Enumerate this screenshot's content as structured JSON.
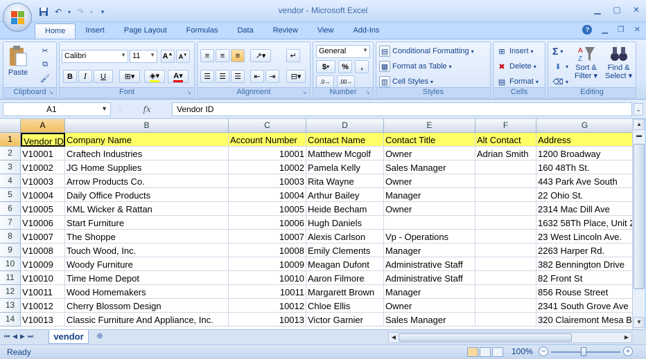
{
  "window": {
    "title": "vendor - Microsoft Excel"
  },
  "ribbon_tabs": [
    "Home",
    "Insert",
    "Page Layout",
    "Formulas",
    "Data",
    "Review",
    "View",
    "Add-Ins"
  ],
  "ribbon": {
    "clipboard": {
      "label": "Clipboard",
      "paste": "Paste"
    },
    "font": {
      "label": "Font",
      "name": "Calibri",
      "size": "11",
      "bold": "B",
      "italic": "I",
      "underline": "U"
    },
    "alignment": {
      "label": "Alignment"
    },
    "number": {
      "label": "Number",
      "format": "General",
      "currency": "$",
      "percent": "%",
      "comma": ","
    },
    "styles": {
      "label": "Styles",
      "conditional": "Conditional Formatting",
      "format_table": "Format as Table",
      "cell_styles": "Cell Styles"
    },
    "cells": {
      "label": "Cells",
      "insert": "Insert",
      "delete": "Delete",
      "format": "Format"
    },
    "editing": {
      "label": "Editing",
      "sum": "Σ",
      "sort": "Sort &",
      "filter": "Filter",
      "find": "Find &",
      "select": "Select"
    }
  },
  "formula_bar": {
    "name_box": "A1",
    "fx": "fx",
    "content": "Vendor ID"
  },
  "grid": {
    "columns": [
      "A",
      "B",
      "C",
      "D",
      "E",
      "F",
      "G"
    ],
    "rows": [
      [
        "Vendor ID",
        "Company Name",
        "Account Number",
        "Contact Name",
        "Contact Title",
        "Alt Contact",
        "Address"
      ],
      [
        "V10001",
        "Craftech Industries",
        "10001",
        "Matthew Mcgolf",
        "Owner",
        "Adrian Smith",
        "1200 Broadway"
      ],
      [
        "V10002",
        "JG Home Supplies",
        "10002",
        "Pamela Kelly",
        "Sales Manager",
        "",
        "160 48Th St."
      ],
      [
        "V10003",
        "Arrow Products Co.",
        "10003",
        "Rita Wayne",
        "Owner",
        "",
        "443 Park Ave South"
      ],
      [
        "V10004",
        "Daily Office Products",
        "10004",
        "Arthur Bailey",
        "Manager",
        "",
        "22 Ohio St."
      ],
      [
        "V10005",
        "KML Wicker & Rattan",
        "10005",
        "Heide Becham",
        "Owner",
        "",
        "2314 Mac Dill Ave"
      ],
      [
        "V10006",
        "Start Furniture",
        "10006",
        "Hugh Daniels",
        "",
        "",
        "1632 58Th Place, Unit 2"
      ],
      [
        "V10007",
        "The Shoppe",
        "10007",
        "Alexis Carlson",
        "Vp - Operations",
        "",
        "23 West Lincoln Ave."
      ],
      [
        "V10008",
        "Touch Wood, Inc.",
        "10008",
        "Emily Clements",
        "Manager",
        "",
        "2263 Harper Rd."
      ],
      [
        "V10009",
        "Woody Furniture",
        "10009",
        "Meagan Dufont",
        "Administrative Staff",
        "",
        "382 Bennington Drive"
      ],
      [
        "V10010",
        "Time Home Depot",
        "10010",
        "Aaron Filmore",
        "Administrative Staff",
        "",
        "82 Front St"
      ],
      [
        "V10011",
        "Wood Homemakers",
        "10011",
        "Margarett Brown",
        "Manager",
        "",
        "856 Rouse Street"
      ],
      [
        "V10012",
        "Cherry Blossom Design",
        "10012",
        "Chloe Ellis",
        "Owner",
        "",
        "2341 South Grove Ave"
      ],
      [
        "V10013",
        "Classic Furniture And Appliance, Inc.",
        "10013",
        "Victor Garnier",
        "Sales Manager",
        "",
        "320 Clairemont Mesa B"
      ]
    ]
  },
  "sheets": {
    "active": "vendor"
  },
  "status": {
    "text": "Ready",
    "zoom": "100%"
  }
}
